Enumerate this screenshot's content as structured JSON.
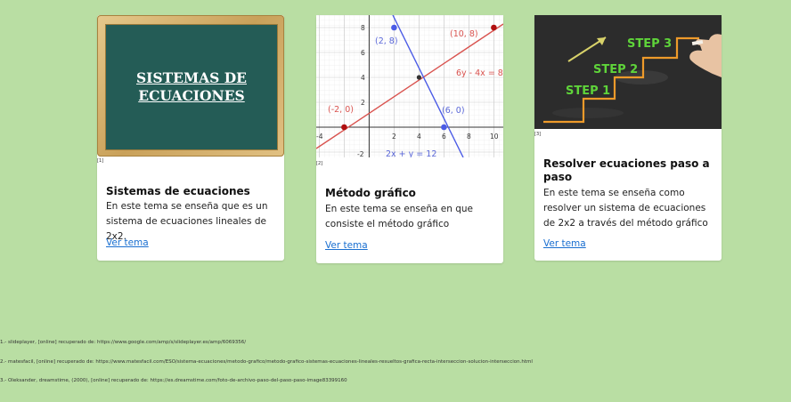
{
  "cards": [
    {
      "board_text": "SISTEMAS DE ECUACIONES",
      "ref": "[1]",
      "title": "Sistemas de ecuaciones",
      "text": "En este tema se enseña que es un sistema de ecuaciones lineales de 2x2.",
      "link": "Ver tema"
    },
    {
      "ref": "[2]",
      "title": "Método gráfico",
      "text": "En este tema se enseña en que consiste el método gráfico",
      "link": "Ver tema",
      "graph": {
        "point_a": "(2, 8)",
        "point_b": "(10, 8)",
        "point_c": "(-2, 0)",
        "point_d": "(6, 0)",
        "eq1": "6y - 4x = 8",
        "eq2": "2x + y = 12",
        "y_ticks": [
          "8",
          "6",
          "4",
          "2",
          "-2"
        ],
        "x_ticks": [
          "-4",
          "2",
          "4",
          "6",
          "8",
          "10"
        ]
      }
    },
    {
      "ref": "[3]",
      "title": "Resolver ecuaciones paso a paso",
      "text": "En este tema se enseña como resolver un sistema de ecuaciones de 2x2 a través del método gráfico",
      "link": "Ver tema",
      "steps": [
        "STEP 1",
        "STEP 2",
        "STEP 3"
      ]
    }
  ],
  "footnotes": [
    "1.- slideplayer, [online] recuperado de: https://www.google.com/amp/s/slideplayer.es/amp/6069356/",
    "2.- matesfacil, [online] recuperado de: https://www.matesfacil.com/ESO/sistema-ecuaciones/metodo-grafico/metodo-grafico-sistemas-ecuaciones-lineales-resueltos-grafica-recta-interseccion-solucion-interseccion.html",
    "3.- Oleksander, dreamstime, (2000), [online] recuperado de: https://es.dreamstime.com/foto-de-archivo-paso-del-paso-paso-image83399160"
  ]
}
